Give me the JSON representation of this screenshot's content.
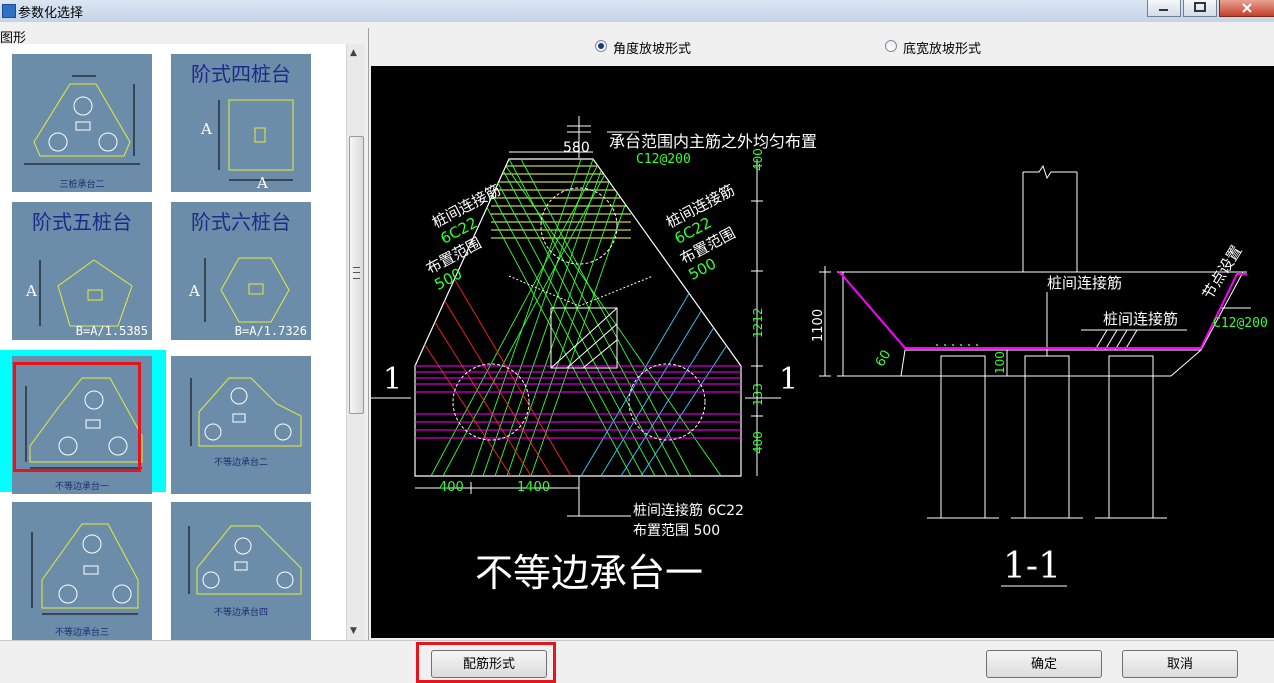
{
  "window": {
    "title": "参数化选择"
  },
  "left_panel": {
    "group_label": "图形",
    "items": [
      {
        "caption": "三桩承台二"
      },
      {
        "title": "阶式四桩台",
        "dim": "A"
      },
      {
        "title": "阶式五桩台",
        "dim": "A",
        "ratio": "B=A/1.5385"
      },
      {
        "title": "阶式六桩台",
        "dim": "A",
        "ratio": "B=A/1.7326"
      },
      {
        "caption": "不等边承台一",
        "selected": true
      },
      {
        "caption": "不等边承台二"
      },
      {
        "caption": "不等边承台三"
      },
      {
        "caption": "不等边承台四"
      }
    ]
  },
  "options": [
    {
      "label": "角度放坡形式",
      "checked": true
    },
    {
      "label": "底宽放坡形式",
      "checked": false
    }
  ],
  "drawing": {
    "plan_title": "不等边承台一",
    "section_title": "1-1",
    "section_mark": "1",
    "labels": {
      "note_top": "承台范围内主筋之外均匀布置",
      "rebar_top": "C12@200",
      "tie_rebar": "桩间连接筋",
      "tie_spec": "6C22",
      "layout_range": "布置范围",
      "range_value": "500",
      "section_tie": "桩间连接筋",
      "node_setting": "节点设置",
      "section_rebar": "C12@200",
      "angle": "60",
      "bottom_tie_line1": "桩间连接筋 6C22",
      "bottom_tie_line2": "布置范围 500"
    },
    "dimensions": {
      "top_width": "580",
      "h1": "400",
      "h2": "1212",
      "h3": "133",
      "h4": "400",
      "bottom_left": "400",
      "bottom_mid": "1400",
      "section_height": "1100",
      "section_bottom": "100"
    }
  },
  "buttons": {
    "rebar_form": "配筋形式",
    "ok": "确定",
    "cancel": "取消"
  },
  "colors": {
    "highlight": "#00ffff",
    "callout": "#e4161c",
    "rebar_green": "#33ff33",
    "rebar_magenta": "#ff00ff"
  }
}
